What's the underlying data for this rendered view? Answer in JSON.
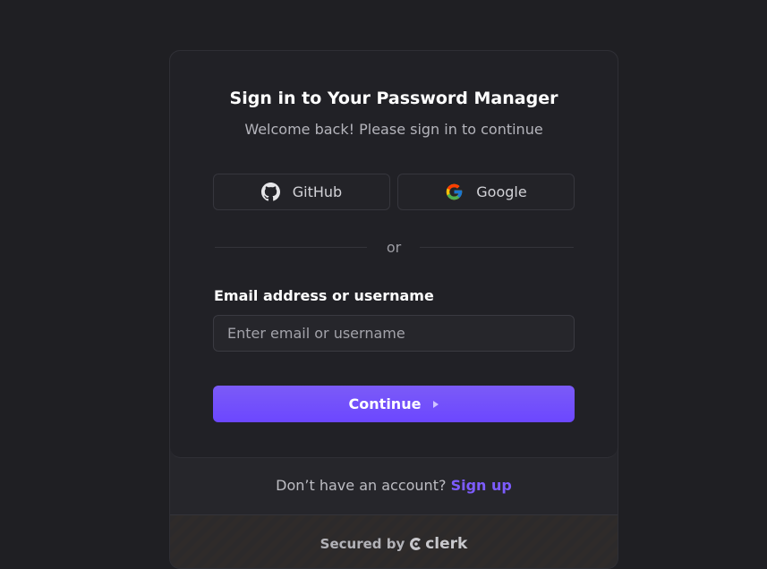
{
  "header": {
    "title": "Sign in to Your Password Manager",
    "subtitle": "Welcome back! Please sign in to continue"
  },
  "social": {
    "github": {
      "label": "GitHub",
      "icon": "github-icon"
    },
    "google": {
      "label": "Google",
      "icon": "google-icon"
    }
  },
  "divider": {
    "text": "or"
  },
  "form": {
    "email_label": "Email address or username",
    "email_placeholder": "Enter email or username",
    "email_value": "",
    "continue_label": "Continue"
  },
  "footer": {
    "signup_prompt": "Don’t have an account?",
    "signup_link": "Sign up",
    "secured_by": "Secured by",
    "brand": "clerk"
  },
  "colors": {
    "background": "#1f1f23",
    "accent": "#6c47ff",
    "link": "#7d5cff"
  }
}
